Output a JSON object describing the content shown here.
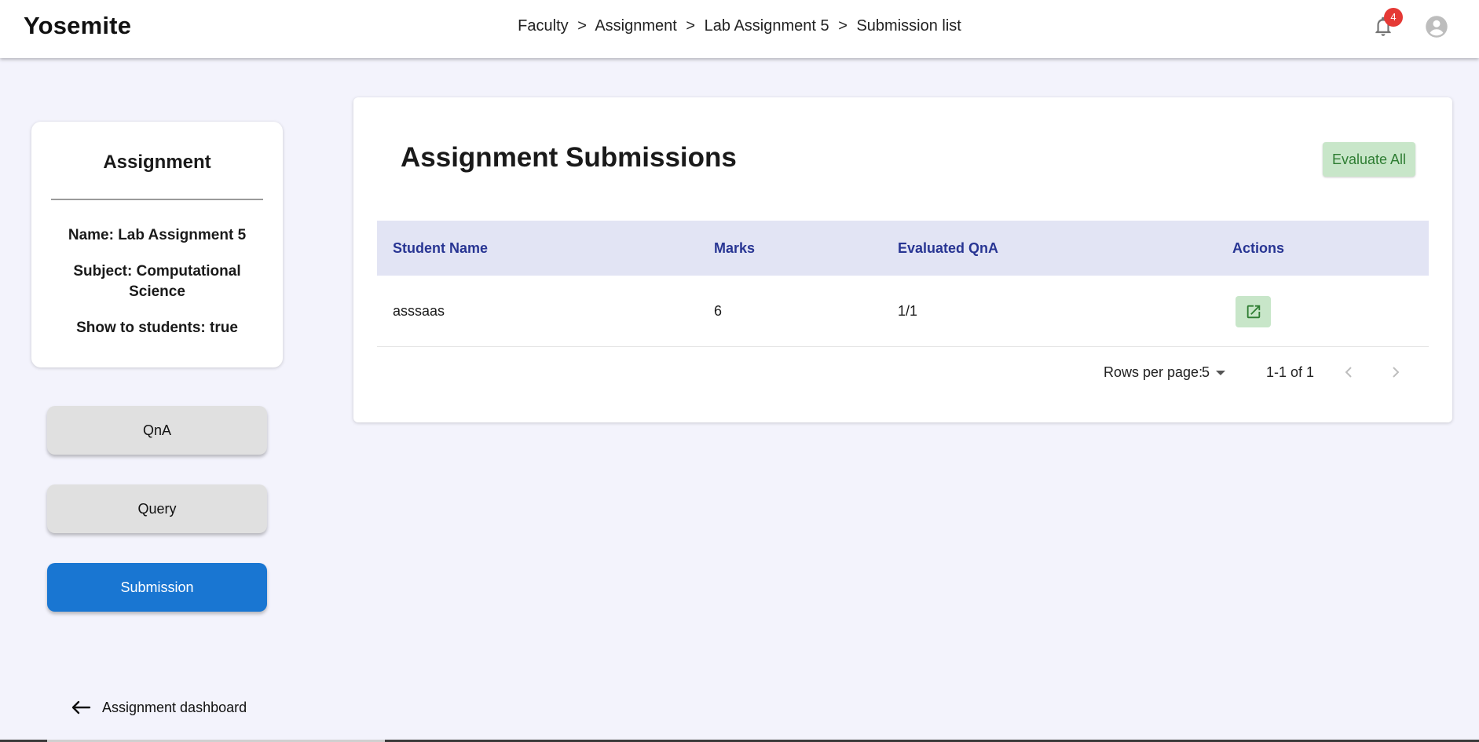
{
  "header": {
    "brand": "Yosemite",
    "breadcrumb": [
      "Faculty",
      "Assignment",
      "Lab Assignment 5",
      "Submission list"
    ],
    "breadcrumb_separator": ">",
    "notifications_count": "4",
    "icons": {
      "notifications": "bell-icon",
      "account": "account-circle-icon"
    }
  },
  "sidebar": {
    "card": {
      "title": "Assignment",
      "name_line": "Name: Lab Assignment 5",
      "subject_line": "Subject: Computational Science",
      "show_line": "Show to students: true"
    },
    "nav": {
      "qna": "QnA",
      "query": "Query",
      "submission": "Submission",
      "active": "submission"
    },
    "back_link": "Assignment dashboard"
  },
  "main": {
    "title": "Assignment Submissions",
    "evaluate_all": "Evaluate All",
    "table": {
      "columns": [
        "Student Name",
        "Marks",
        "Evaluated QnA",
        "Actions"
      ],
      "rows": [
        {
          "student_name": "asssaas",
          "marks": "6",
          "evaluated_qna": "1/1",
          "action_icon": "open-in-new-icon"
        }
      ]
    },
    "pagination": {
      "rows_per_page_label": "Rows per page:",
      "rows_per_page": "5",
      "range": "1-1 of 1"
    }
  },
  "colors": {
    "page_bg": "#f3f3fc",
    "primary": "#1976d2",
    "success_bg": "#c8e6c9",
    "success_text": "#2e7d32",
    "table_header_bg": "#e2e4f4",
    "table_header_text": "#283593",
    "badge": "#e53935"
  }
}
